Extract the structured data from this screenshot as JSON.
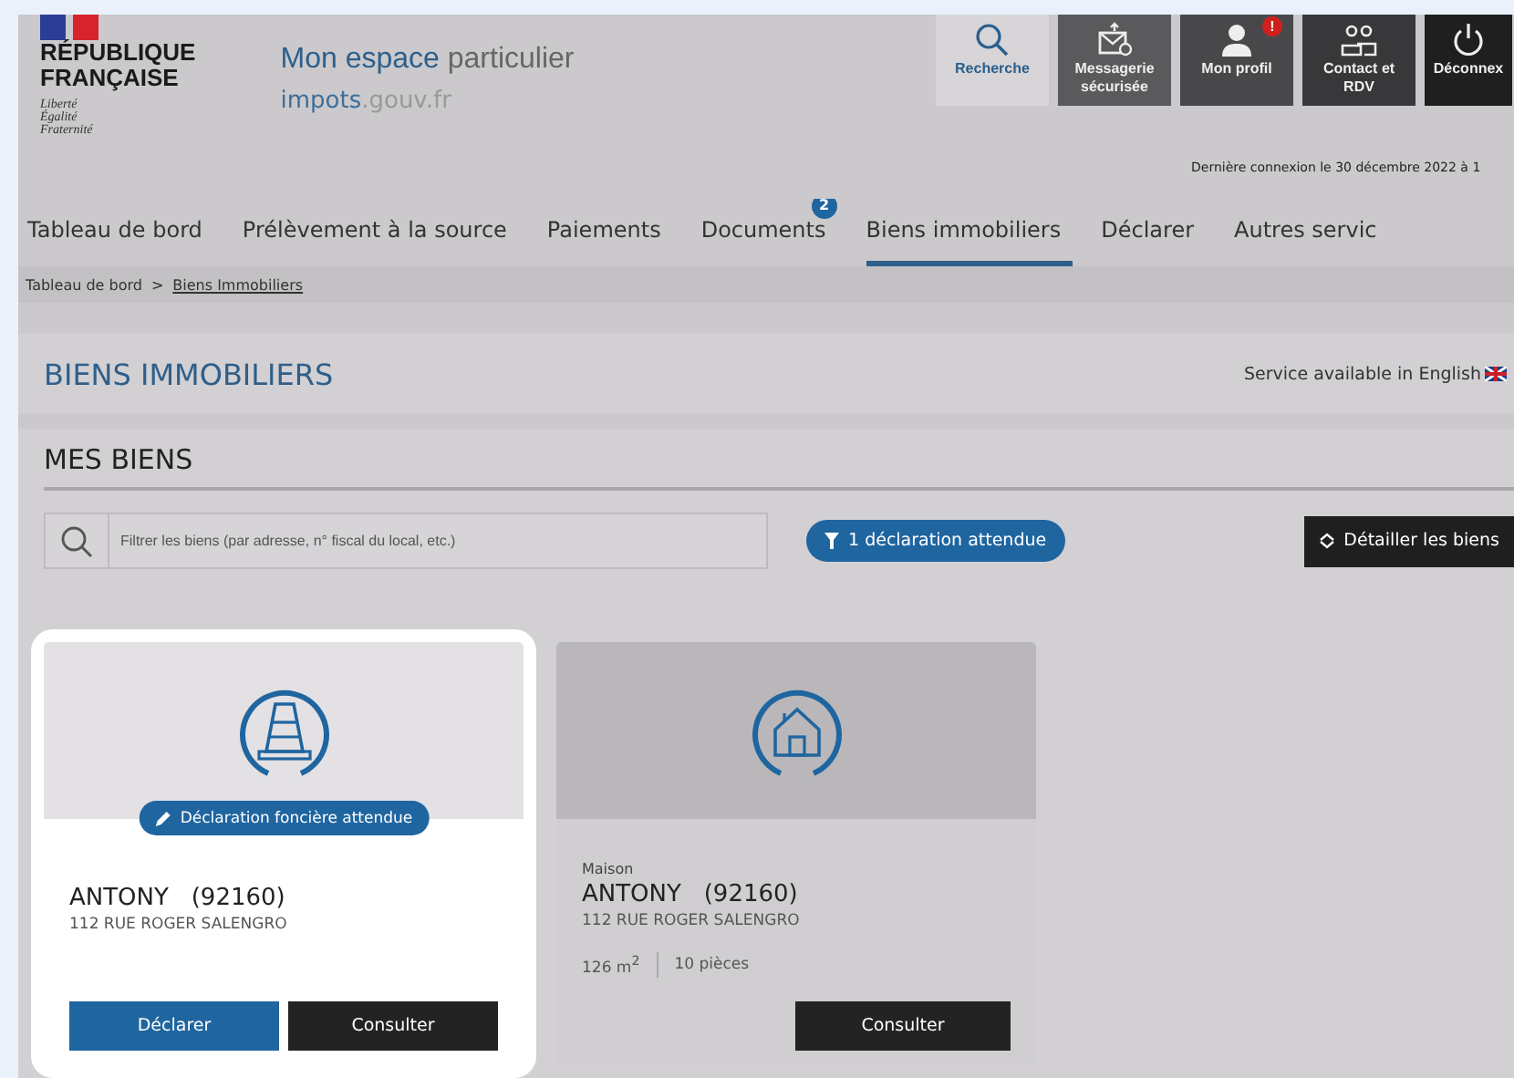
{
  "logo": {
    "country": [
      "RÉPUBLIQUE",
      "FRANÇAISE"
    ],
    "motto": [
      "Liberté",
      "Égalité",
      "Fraternité"
    ]
  },
  "site": {
    "title_strong": "Mon espace",
    "title_rest": "particulier",
    "domain_strong": "impots",
    "domain_rest": ".gouv.fr"
  },
  "top_buttons": [
    {
      "kind": "search",
      "label": "Recherche",
      "alert": false
    },
    {
      "kind": "mail",
      "label": "Messagerie sécurisée",
      "alert": false
    },
    {
      "kind": "profile",
      "label": "Mon profil",
      "alert": "!"
    },
    {
      "kind": "contact",
      "label": "Contact et RDV",
      "alert": false
    },
    {
      "kind": "logout",
      "label": "Déconnex",
      "alert": false
    }
  ],
  "last_login": "Dernière connexion le 30 décembre 2022 à 1",
  "nav": [
    {
      "label": "Tableau de bord",
      "selected": false
    },
    {
      "label": "Prélèvement à la source",
      "selected": false
    },
    {
      "label": "Paiements",
      "selected": false
    },
    {
      "label": "Documents",
      "selected": false,
      "badge": "2"
    },
    {
      "label": "Biens immobiliers",
      "selected": true
    },
    {
      "label": "Déclarer",
      "selected": false
    },
    {
      "label": "Autres servic",
      "selected": false
    }
  ],
  "breadcrumb": [
    {
      "label": "Tableau de bord",
      "current": false
    },
    {
      "label": "Biens Immobiliers",
      "current": true
    }
  ],
  "breadcrumb_separator": ">",
  "page_title": "BIENS IMMOBILIERS",
  "language_link": "Service available in English",
  "section_title": "MES BIENS",
  "search": {
    "placeholder": "Filtrer les biens (par adresse, n° fiscal du local, etc.)"
  },
  "filter_chip": "1 déclaration attendue",
  "detail_button": "Détailler les biens",
  "cards": [
    {
      "kind": "cone",
      "highlighted": true,
      "status": "Déclaration foncière attendue",
      "city": "ANTONY   (92160)",
      "address": "112 RUE ROGER SALENGRO",
      "buttons": [
        {
          "kind": "primary",
          "label": "Déclarer"
        },
        {
          "kind": "dark",
          "label": "Consulter"
        }
      ]
    },
    {
      "kind": "house",
      "highlighted": false,
      "type": "Maison",
      "city": "ANTONY   (92160)",
      "address": "112 RUE ROGER SALENGRO",
      "area": "126 m$^{2}$",
      "rooms": "10 pièces",
      "buttons": [
        {
          "kind": "dark",
          "label": "Consulter"
        }
      ]
    }
  ]
}
